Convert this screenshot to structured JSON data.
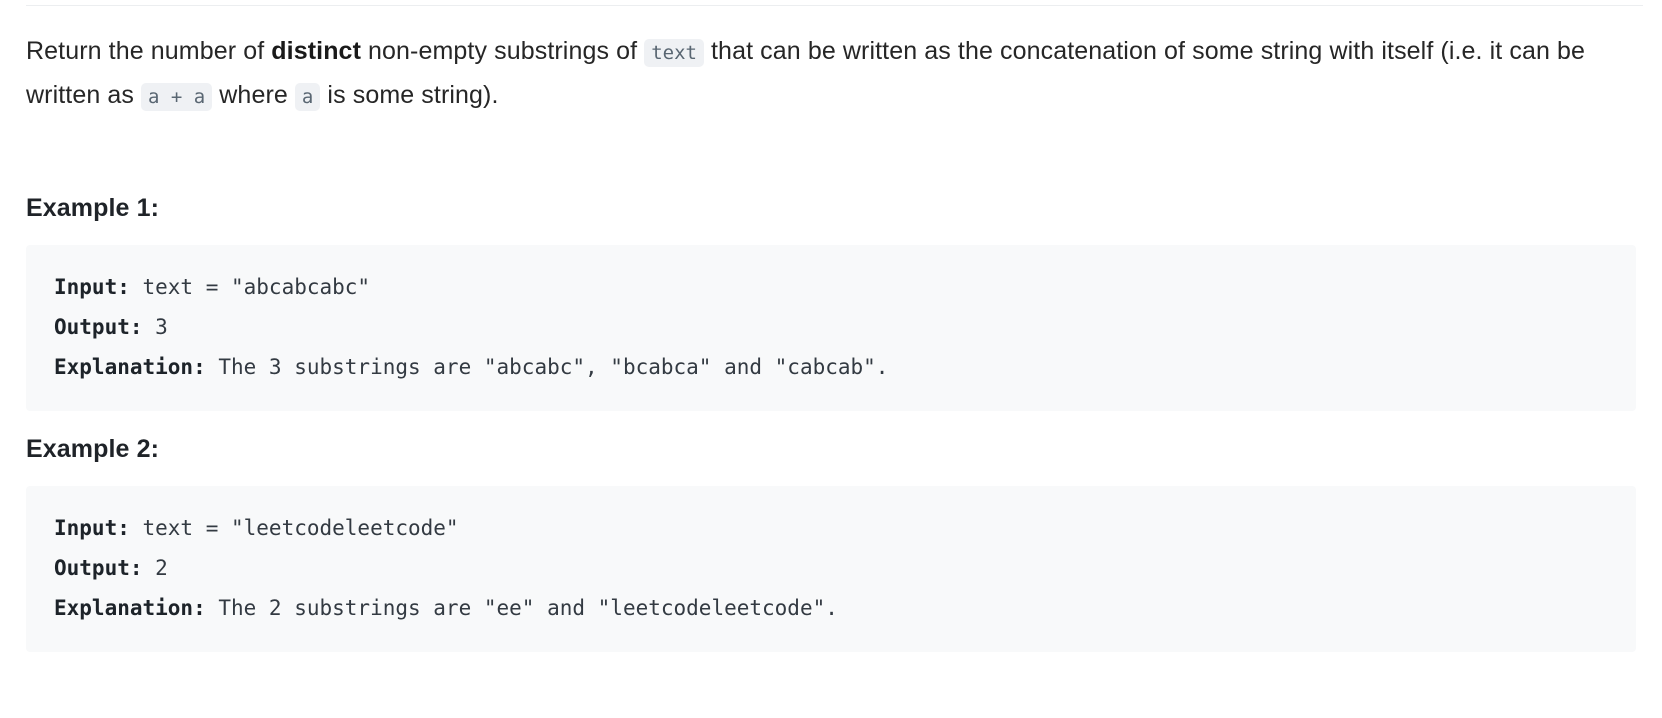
{
  "problem": {
    "description": {
      "part1": "Return the number of ",
      "bold1": "distinct",
      "part2": " non-empty substrings of ",
      "code1": "text",
      "part3": " that can be written as the concatenation of some string with itself (i.e. it can be written as ",
      "code2": "a + a",
      "part4": " where ",
      "code3": "a",
      "part5": " is some string)."
    },
    "examples": [
      {
        "heading": "Example 1:",
        "lines": [
          {
            "label": "Input:",
            "value": " text = \"abcabcabc\""
          },
          {
            "label": "Output:",
            "value": " 3"
          },
          {
            "label": "Explanation:",
            "value": " The 3 substrings are \"abcabc\", \"bcabca\" and \"cabcab\"."
          }
        ]
      },
      {
        "heading": "Example 2:",
        "lines": [
          {
            "label": "Input:",
            "value": " text = \"leetcodeleetcode\""
          },
          {
            "label": "Output:",
            "value": " 2"
          },
          {
            "label": "Explanation:",
            "value": " The 2 substrings are \"ee\" and \"leetcodeleetcode\"."
          }
        ]
      }
    ]
  },
  "colors": {
    "page_background": "#ffffff",
    "text": "#262626",
    "code_block_background": "#f8f9fa",
    "inline_code_background": "#eff1f4",
    "inline_code_text": "#596672",
    "divider": "#eceef0"
  }
}
